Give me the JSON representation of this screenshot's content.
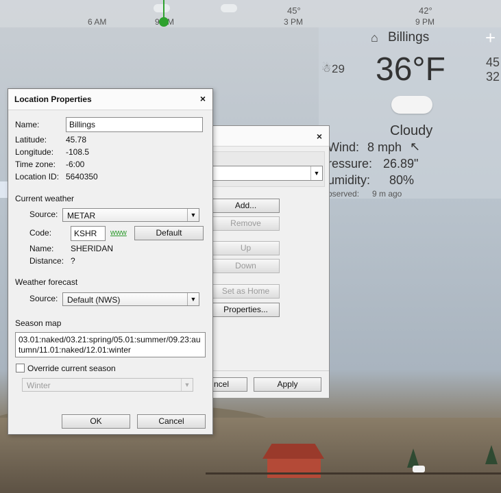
{
  "background": {
    "hours": [
      {
        "time": "6 AM"
      },
      {
        "time": "9 PM"
      },
      {
        "time": "3 PM",
        "temp": "45°"
      },
      {
        "time": "9 PM",
        "temp": "42°"
      }
    ],
    "location": "Billings",
    "wind_chill": "29",
    "right_temp_top": "45",
    "right_temp_bottom": "32",
    "temperature": "36°F",
    "condition": "Cloudy",
    "wind_label": "Wind:",
    "wind_value": "8 mph",
    "pressure_label": "ressure:",
    "pressure_value": "26.89\"",
    "humidity_label": "umidity:",
    "humidity_value": "80%",
    "observed_label": "bserved:",
    "observed_value": "9 m ago"
  },
  "behind_dialog": {
    "buttons": {
      "add": "Add...",
      "remove": "Remove",
      "up": "Up",
      "down": "Down",
      "set_home": "Set as Home",
      "properties": "Properties..."
    },
    "footer": {
      "cancel": "ncel",
      "apply": "Apply"
    }
  },
  "dialog": {
    "title": "Location Properties",
    "close": "×",
    "name_label": "Name:",
    "name_value": "Billings",
    "latitude_label": "Latitude:",
    "latitude_value": "45.78",
    "longitude_label": "Longitude:",
    "longitude_value": "-108.5",
    "timezone_label": "Time zone:",
    "timezone_value": "-6:00",
    "locid_label": "Location ID:",
    "locid_value": "5640350",
    "current_weather": {
      "header": "Current weather",
      "source_label": "Source:",
      "source_value": "METAR",
      "code_label": "Code:",
      "code_value": "KSHR",
      "www": "www",
      "default_button": "Default",
      "name_label": "Name:",
      "name_value": "SHERIDAN",
      "distance_label": "Distance:",
      "distance_value": "?"
    },
    "forecast": {
      "header": "Weather forecast",
      "source_label": "Source:",
      "source_value": "Default (NWS)"
    },
    "season_map": {
      "header": "Season map",
      "value": "03.01:naked/03.21:spring/05.01:summer/09.23:autumn/11.01:naked/12.01:winter"
    },
    "override": {
      "label": "Override current season",
      "checked": false,
      "season_value": "Winter"
    },
    "ok": "OK",
    "cancel": "Cancel"
  },
  "colors": {
    "link": "#2c9a2c",
    "dialog_bg": "#f0f0f0",
    "sun_marker": "#2ea12e"
  }
}
